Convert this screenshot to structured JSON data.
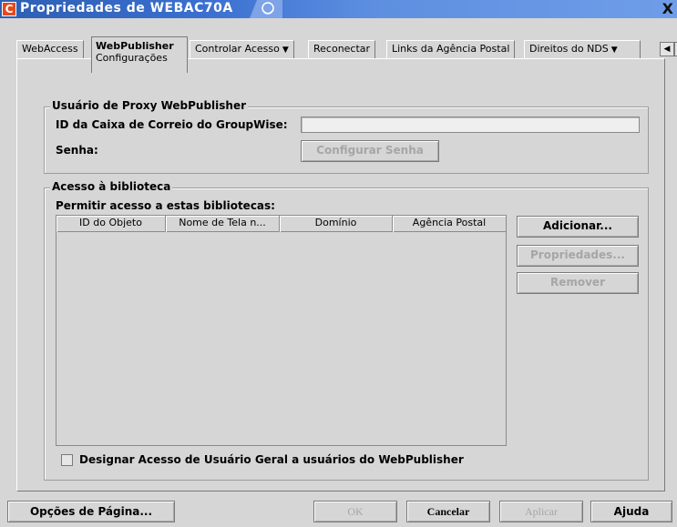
{
  "window": {
    "title": "Propriedades de WEBAC70A",
    "app_icon_letter": "C",
    "close_label": "X"
  },
  "tabs": [
    {
      "label": "WebAccess"
    },
    {
      "label": "WebPublisher",
      "sub": "Configurações",
      "active": true
    },
    {
      "label": "Controlar Acesso",
      "caret": "▼"
    },
    {
      "label": "Reconectar"
    },
    {
      "label": "Links da Agência Postal"
    },
    {
      "label": "Direitos do NDS",
      "caret": "▼"
    }
  ],
  "tab_scroll": {
    "left": "◀",
    "right": "▶"
  },
  "proxy_group": {
    "legend": "Usuário de Proxy WebPublisher",
    "mailbox_label": "ID da Caixa de Correio do GroupWise:",
    "mailbox_value": "",
    "password_label": "Senha:",
    "set_password_button": "Configurar Senha"
  },
  "library_group": {
    "legend": "Acesso à biblioteca",
    "allow_label": "Permitir acesso a estas bibliotecas:",
    "columns": [
      "ID do Objeto",
      "Nome de Tela n...",
      "Domínio",
      "Agência Postal"
    ],
    "rows": [],
    "add_button": "Adicionar...",
    "properties_button": "Propriedades...",
    "remove_button": "Remover",
    "general_access_checkbox": "Designar Acesso de Usuário Geral a usuários do WebPublisher",
    "general_access_checked": false
  },
  "footer": {
    "page_options": "Opções de Página...",
    "ok": "OK",
    "cancel": "Cancelar",
    "apply": "Aplicar",
    "help": "Ajuda"
  }
}
